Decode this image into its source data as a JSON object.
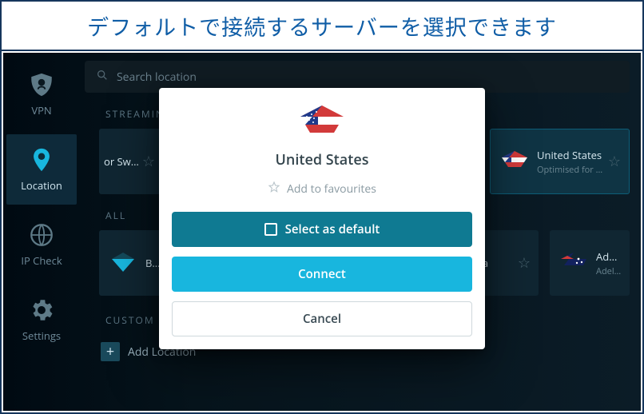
{
  "banner": {
    "text": "デフォルトで接続するサーバーを選択できます"
  },
  "sidebar": {
    "items": [
      {
        "label": "VPN"
      },
      {
        "label": "Location"
      },
      {
        "label": "IP Check"
      },
      {
        "label": "Settings"
      }
    ]
  },
  "search": {
    "placeholder": "Search location"
  },
  "sections": {
    "streaming": "STREAMING",
    "all": "ALL",
    "custom": "CUSTOM LOC"
  },
  "cards": {
    "streaming_swed": {
      "title": "or Swed..",
      "sub": ""
    },
    "streaming_us": {
      "title": "United States",
      "sub": "Optimised for US st.."
    },
    "all_best": {
      "title": "Best Locat",
      "sub": ""
    },
    "all_au1": {
      "title": "stralia",
      "sub": ""
    },
    "all_adelaide": {
      "title": "Adelaide",
      "sub": "Adelaide"
    }
  },
  "addLocation": {
    "label": "Add Location"
  },
  "modal": {
    "country": "United States",
    "favourite": "Add to favourites",
    "select_default": "Select as default",
    "connect": "Connect",
    "cancel": "Cancel"
  }
}
